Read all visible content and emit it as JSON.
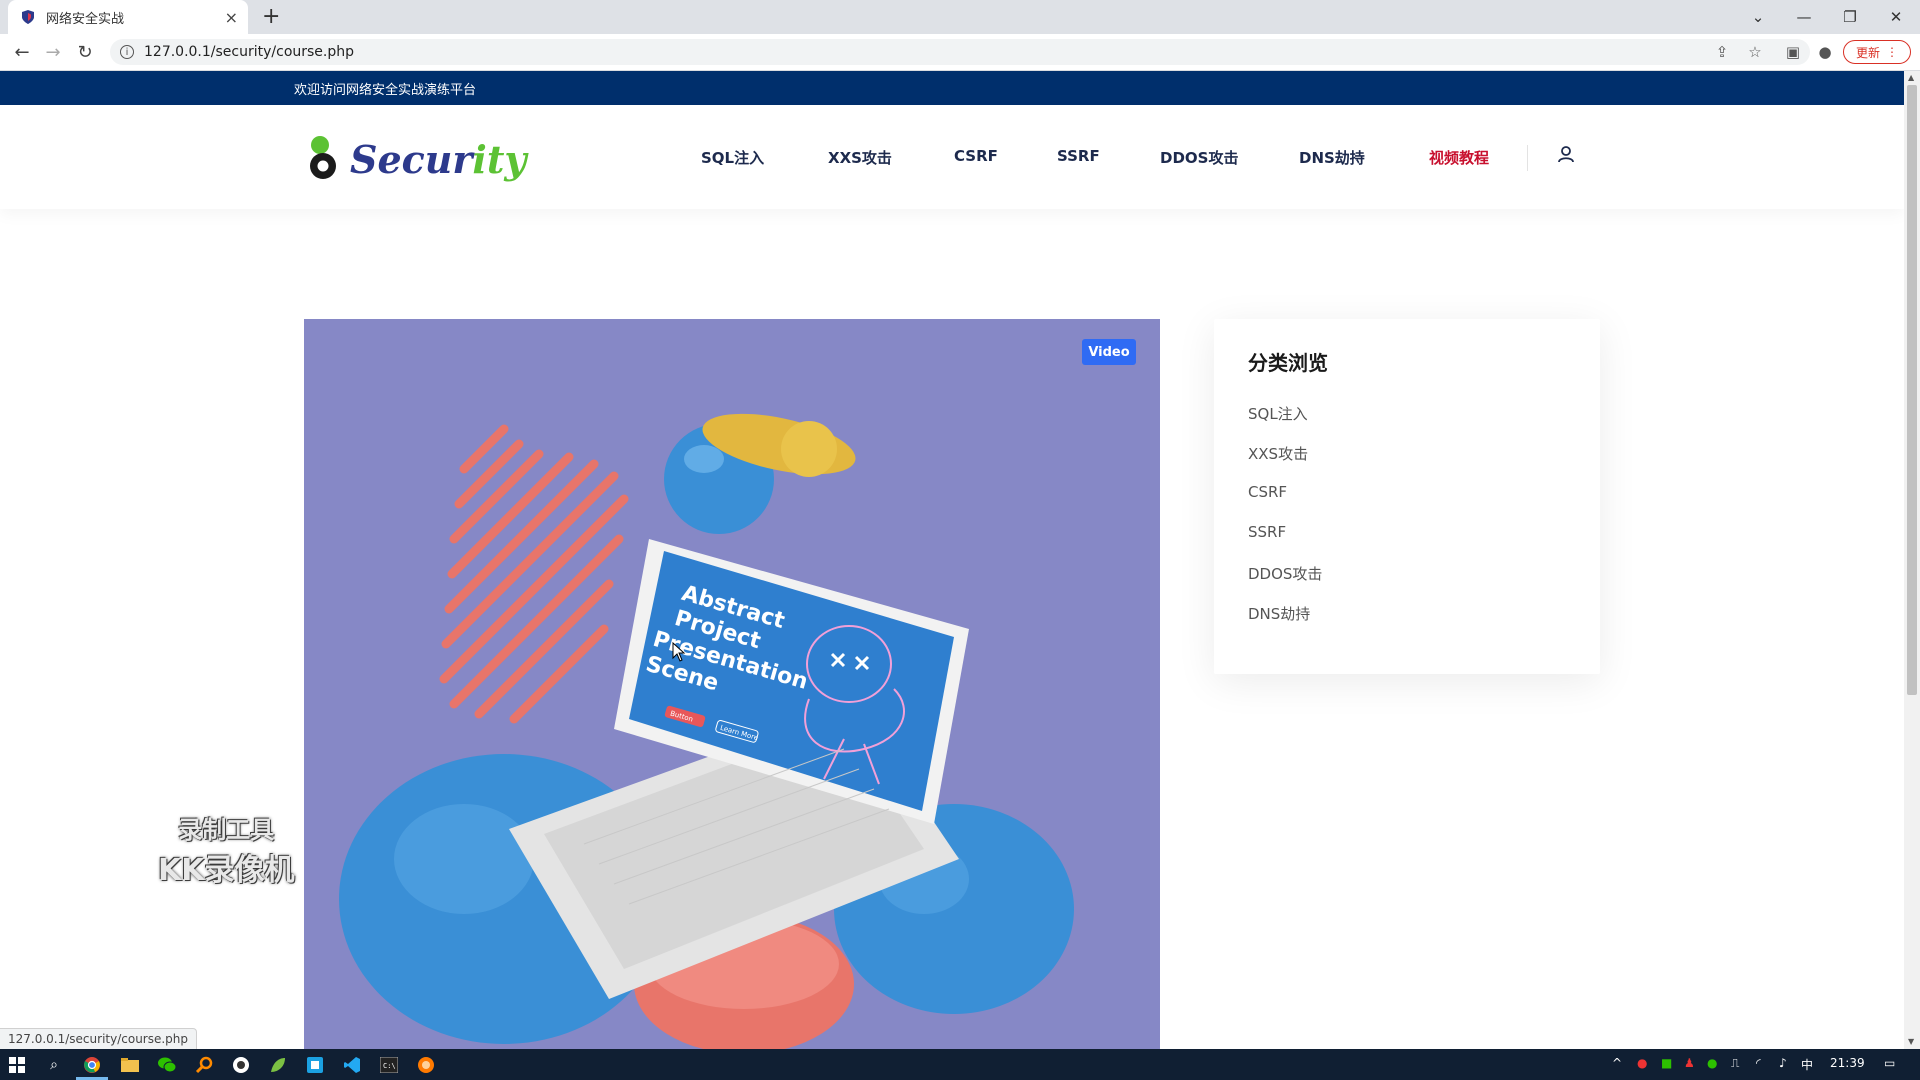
{
  "browser": {
    "tab_title": "网络安全实战",
    "tab_close": "×",
    "new_tab": "+",
    "url": "127.0.0.1/security/course.php",
    "update_label": "更新"
  },
  "site": {
    "topbar_text": "欢迎访问网络安全实战演练平台",
    "logo_part1": "Secur",
    "logo_part2": "ity",
    "nav": [
      {
        "label": "SQL注入",
        "active": false
      },
      {
        "label": "XXS攻击",
        "active": false
      },
      {
        "label": "CSRF",
        "active": false
      },
      {
        "label": "SSRF",
        "active": false
      },
      {
        "label": "DDOS攻击",
        "active": false
      },
      {
        "label": "DNS劫持",
        "active": false
      },
      {
        "label": "视频教程",
        "active": true
      }
    ],
    "accent_color": "#c8102e",
    "topbar_color": "#002f6c"
  },
  "hero": {
    "badge": "Video",
    "screen_text": [
      "Abstract",
      "Project",
      "Presentation",
      "Scene"
    ],
    "screen_buttons": [
      "Button",
      "Learn More"
    ]
  },
  "sidebar": {
    "title": "分类浏览",
    "items": [
      "SQL注入",
      "XXS攻击",
      "CSRF",
      "SSRF",
      "DDOS攻击",
      "DNS劫持"
    ]
  },
  "watermark": {
    "line1": "录制工具",
    "line2": "KK录像机"
  },
  "status_url": "127.0.0.1/security/course.php",
  "taskbar": {
    "ime": "中",
    "time": "21:39"
  }
}
